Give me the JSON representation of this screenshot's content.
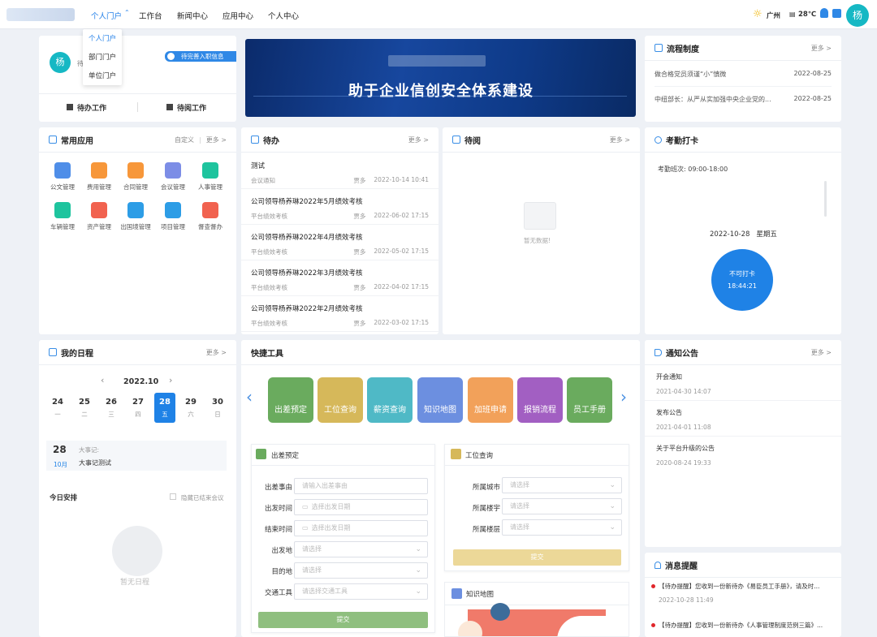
{
  "topbar": {
    "nav": [
      "个人门户",
      "工作台",
      "新闻中心",
      "应用中心",
      "个人中心"
    ],
    "dropdown": [
      "个人门户",
      "部门门户",
      "单位门户"
    ],
    "city": "广州",
    "temp": "28℃",
    "avatar": "杨"
  },
  "profile": {
    "avatar": "杨",
    "name_fragment": "待",
    "badge": "待完善入职信息",
    "todo_btn": "待办工作",
    "read_btn": "待阅工作"
  },
  "banner": {
    "text": "助于企业信创安全体系建设"
  },
  "process": {
    "title": "流程制度",
    "more": "更多 >",
    "items": [
      {
        "text": "做合格党员须谨“小”慎微",
        "date": "2022-08-25"
      },
      {
        "text": "中纽部长：从严从实加强中央企业党的...",
        "date": "2022-08-25"
      }
    ]
  },
  "apps": {
    "title": "常用应用",
    "customize": "自定义",
    "more": "更多 >",
    "items": [
      {
        "label": "公文管理",
        "color": "#4f8ee8"
      },
      {
        "label": "费用管理",
        "color": "#f7973a"
      },
      {
        "label": "合同管理",
        "color": "#f7973a"
      },
      {
        "label": "会议管理",
        "color": "#7c8de6"
      },
      {
        "label": "人事管理",
        "color": "#1ec49e"
      },
      {
        "label": "车辆管理",
        "color": "#1ec49e"
      },
      {
        "label": "资产管理",
        "color": "#f1624f"
      },
      {
        "label": "出国境管理",
        "color": "#2d9de6"
      },
      {
        "label": "项目管理",
        "color": "#2d9de6"
      },
      {
        "label": "督查督办",
        "color": "#f1624f"
      }
    ]
  },
  "todo": {
    "title": "待办",
    "more": "更多 >",
    "items": [
      {
        "title": "测试",
        "source": "会议通知",
        "who": "贾多",
        "time": "2022-10-14 10:41"
      },
      {
        "title": "公司领导杨养琳2022年5月绩效考核",
        "source": "平台绩效考核",
        "who": "贾多",
        "time": "2022-06-02 17:15"
      },
      {
        "title": "公司领导杨养琳2022年4月绩效考核",
        "source": "平台绩效考核",
        "who": "贾多",
        "time": "2022-05-02 17:15"
      },
      {
        "title": "公司领导杨养琳2022年3月绩效考核",
        "source": "平台绩效考核",
        "who": "贾多",
        "time": "2022-04-02 17:15"
      },
      {
        "title": "公司领导杨养琳2022年2月绩效考核",
        "source": "平台绩效考核",
        "who": "贾多",
        "time": "2022-03-02 17:15"
      }
    ]
  },
  "toread": {
    "title": "待阅",
    "more": "更多 >",
    "empty": "暂无数据!"
  },
  "attendance": {
    "title": "考勤打卡",
    "shift": "考勤班次:   09:00-18:00",
    "date": "2022-10-28",
    "weekday": "星期五",
    "status": "不可打卡",
    "time": "18:44:21"
  },
  "schedule": {
    "title": "我的日程",
    "more": "更多 >",
    "month": "2022.10",
    "days": [
      {
        "n": "24",
        "w": "一"
      },
      {
        "n": "25",
        "w": "二"
      },
      {
        "n": "26",
        "w": "三"
      },
      {
        "n": "27",
        "w": "四"
      },
      {
        "n": "28",
        "w": "五"
      },
      {
        "n": "29",
        "w": "六"
      },
      {
        "n": "30",
        "w": "日"
      }
    ],
    "event_day": "28",
    "event_month": "10月",
    "event_tag": "大事记:",
    "event_text": "大事记测试",
    "today": "今日安排",
    "hide_done": "隐藏已结束会议",
    "empty": "暂无日程"
  },
  "tools": {
    "title": "快捷工具",
    "items": [
      {
        "label": "出差预定",
        "color": "#6aab5e"
      },
      {
        "label": "工位查询",
        "color": "#d6b85a"
      },
      {
        "label": "薪资查询",
        "color": "#4fb9c6"
      },
      {
        "label": "知识地图",
        "color": "#6c8fe0"
      },
      {
        "label": "加班申请",
        "color": "#f2a15a"
      },
      {
        "label": "报销流程",
        "color": "#a25fc2"
      },
      {
        "label": "员工手册",
        "color": "#6aab5e"
      }
    ]
  },
  "trip_form": {
    "title": "出差预定",
    "fields": [
      {
        "label": "出差事由",
        "placeholder": "请输入出差事由"
      },
      {
        "label": "出发时间",
        "placeholder": "选择出发日期"
      },
      {
        "label": "结束时间",
        "placeholder": "选择出发日期"
      },
      {
        "label": "出发地",
        "placeholder": "请选择"
      },
      {
        "label": "目的地",
        "placeholder": "请选择"
      },
      {
        "label": "交通工具",
        "placeholder": "请选择交通工具"
      }
    ],
    "submit": "提交"
  },
  "seat_form": {
    "title": "工位查询",
    "fields": [
      {
        "label": "所属城市",
        "placeholder": "请选择"
      },
      {
        "label": "所属楼宇",
        "placeholder": "请选择"
      },
      {
        "label": "所属楼层",
        "placeholder": "请选择"
      }
    ],
    "submit": "提交"
  },
  "knowledge": {
    "title": "知识地图"
  },
  "notices": {
    "title": "通知公告",
    "more": "更多 >",
    "items": [
      {
        "title": "开会通知",
        "date": "2021-04-30 14:07"
      },
      {
        "title": "发布公告",
        "date": "2021-04-01 11:08"
      },
      {
        "title": "关于平台升级的公告",
        "date": "2020-08-24 19:33"
      }
    ]
  },
  "messages": {
    "title": "消息提醒",
    "items": [
      {
        "text": "【待办提醒】您收到一份新待办《易臣员工手册》，请及时...",
        "date": "2022-10-28 11:49"
      },
      {
        "text": "【待办提醒】您收到一份新待办《人事管理制度范例三篇》..."
      }
    ]
  }
}
